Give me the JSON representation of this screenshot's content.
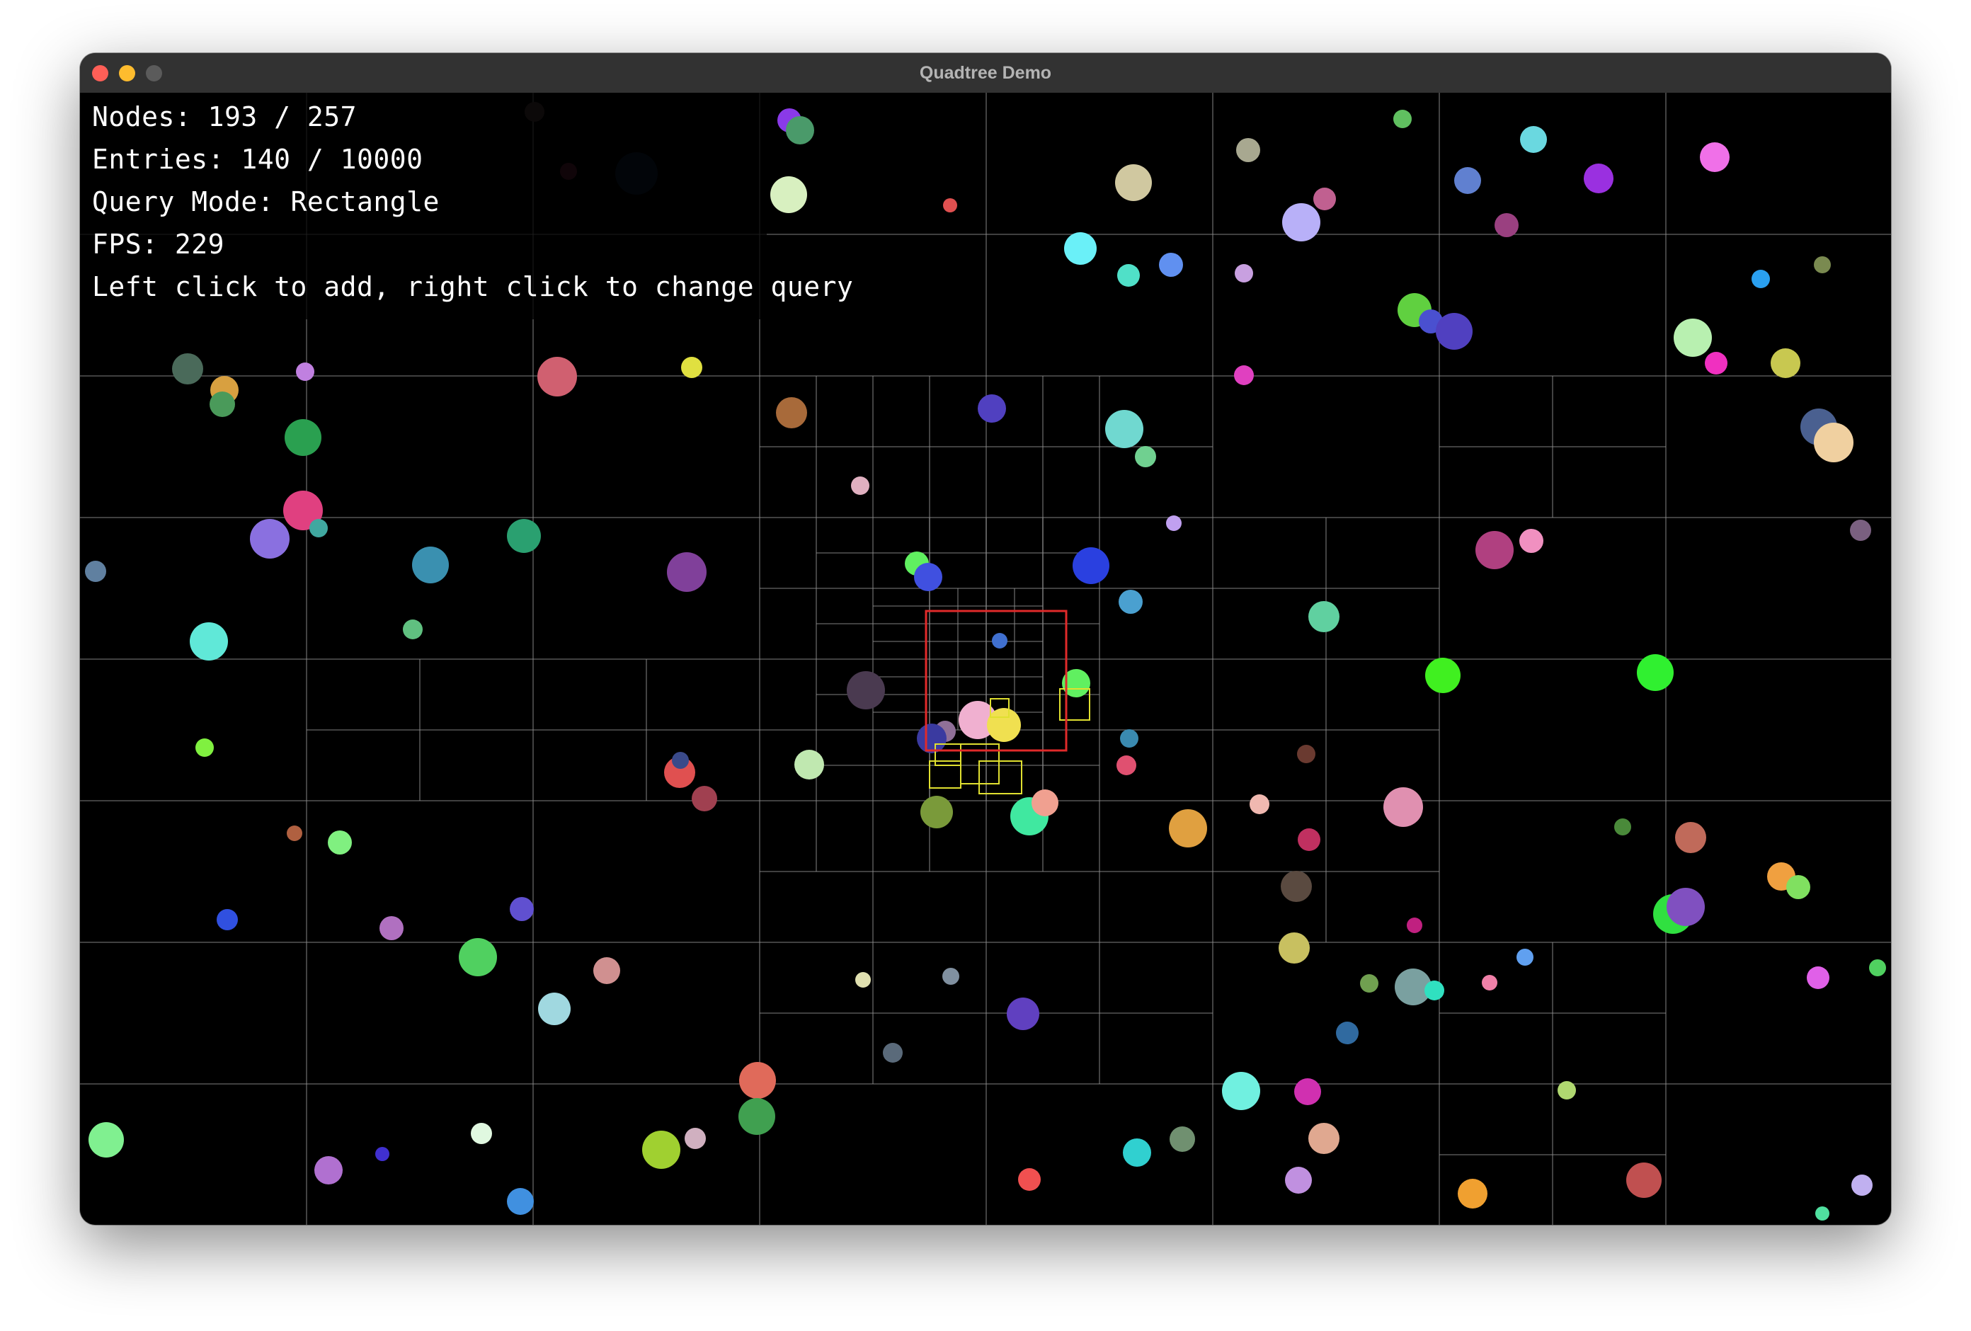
{
  "window": {
    "title": "Quadtree Demo"
  },
  "hud": {
    "nodes": "Nodes: 193 / 257",
    "entries": "Entries: 140 / 10000",
    "query_mode": "Query Mode: Rectangle",
    "fps": "FPS: 229",
    "help": "Left click to add, right click to change query"
  },
  "colors": {
    "background": "#000000",
    "grid_line": "#8a8a8a",
    "query_rect": "#e02a2a",
    "highlight_box": "#e0e030",
    "titlebar": "#323232"
  },
  "icons": {
    "close": "close-traffic-light",
    "minimize": "minimize-traffic-light",
    "zoom": "zoom-traffic-light"
  },
  "balls": [
    [
      "#3a2a2a"
    ],
    [
      "#4a1a2a"
    ],
    [
      "#8a3ae8"
    ],
    [
      "#4a9a6a"
    ],
    [
      "#0a1a2a"
    ],
    [
      "#d8f0c0"
    ],
    [
      "#e05050"
    ],
    [
      "#d0c8a0"
    ],
    [
      "#a8a890"
    ],
    [
      "#60c060"
    ],
    [
      "#6ad8e0"
    ],
    [
      "#6080d0"
    ],
    [
      "#9a30e0"
    ],
    [
      "#f070e8"
    ],
    [
      "#c06090"
    ],
    [
      "#b8b0f8"
    ],
    [
      "#9a4080"
    ],
    [
      "#6af0f8"
    ],
    [
      "#6090f0"
    ],
    [
      "#50e0c8"
    ],
    [
      "#c8a0e0"
    ],
    [
      "#2aa0f0"
    ],
    [
      "#7a8a50"
    ],
    [
      "#60d040"
    ],
    [
      "#4a50d0"
    ],
    [
      "#5040c0"
    ],
    [
      "#b8f0b0"
    ],
    [
      "#c8c850"
    ],
    [
      "#e040c0"
    ],
    [
      "#f030c0"
    ],
    [
      "#4a6a5a"
    ],
    [
      "#d8a040"
    ],
    [
      "#4a9a5a"
    ],
    [
      "#c080e0"
    ],
    [
      "#d06070"
    ],
    [
      "#e0e040"
    ],
    [
      "#a86a3a"
    ],
    [
      "#5040c0"
    ],
    [
      "#70d8d0"
    ],
    [
      "#70d090"
    ],
    [
      "#2aa050"
    ],
    [
      "#e0b0c0"
    ],
    [
      "#4a6090"
    ],
    [
      "#f0d0a0"
    ],
    [
      "#e04080"
    ],
    [
      "#8a70e0"
    ],
    [
      "#40a8a0"
    ],
    [
      "#7a6080"
    ],
    [
      "#2aa070"
    ],
    [
      "#3a90b0"
    ],
    [
      "#80409a"
    ],
    [
      "#c0a0f0"
    ],
    [
      "#b04080"
    ],
    [
      "#f090c0"
    ],
    [
      "#6080a0"
    ],
    [
      "#60f060"
    ],
    [
      "#4050e0"
    ],
    [
      "#2a40e0"
    ],
    [
      "#4aa0d0"
    ],
    [
      "#60d0a0"
    ],
    [
      "#60e8d8"
    ],
    [
      "#60c080"
    ],
    [
      "#30f030"
    ],
    [
      "#4a3a50"
    ],
    [
      "#80f040"
    ],
    [
      "#e05050"
    ],
    [
      "#3a4a8a"
    ],
    [
      "#c0e8b0"
    ],
    [
      "#40f020"
    ],
    [
      "#a04050"
    ],
    [
      "#907098"
    ],
    [
      "#f0b0d0"
    ],
    [
      "#f0e050"
    ],
    [
      "#60f060"
    ],
    [
      "#4070d0"
    ],
    [
      "#3a3aa0"
    ],
    [
      "#7a9a3a"
    ],
    [
      "#40e8a0"
    ],
    [
      "#f0a090"
    ],
    [
      "#e05070"
    ],
    [
      "#3a8ab0"
    ],
    [
      "#6a3a30"
    ],
    [
      "#f0b8b0"
    ],
    [
      "#e0a040"
    ],
    [
      "#c03060"
    ],
    [
      "#e090b0"
    ],
    [
      "#4a8a3a"
    ],
    [
      "#c06a5a"
    ],
    [
      "#f0a040"
    ],
    [
      "#80e060"
    ],
    [
      "#30e040"
    ],
    [
      "#8050c0"
    ],
    [
      "#b06040"
    ],
    [
      "#80f080"
    ],
    [
      "#3050e0"
    ],
    [
      "#b070c0"
    ],
    [
      "#6050d0"
    ],
    [
      "#50d060"
    ],
    [
      "#d09090"
    ],
    [
      "#a0d8e0"
    ],
    [
      "#e0e0b0"
    ],
    [
      "#5a4a40"
    ],
    [
      "#c8c060"
    ],
    [
      "#c02080"
    ],
    [
      "#f080a8"
    ],
    [
      "#8090a0"
    ],
    [
      "#6040c0"
    ],
    [
      "#e06a5a"
    ],
    [
      "#5a6a7a"
    ],
    [
      "#70a050"
    ],
    [
      "#7aa0a0"
    ],
    [
      "#30e0c0"
    ],
    [
      "#306aa0"
    ],
    [
      "#60a0f0"
    ],
    [
      "#e060e8"
    ],
    [
      "#50d060"
    ],
    [
      "#70f0e0"
    ],
    [
      "#d030b0"
    ],
    [
      "#b0d870"
    ],
    [
      "#80f090"
    ],
    [
      "#b070d0"
    ],
    [
      "#4030d0"
    ],
    [
      "#e0f8e0"
    ],
    [
      "#d0b0c0"
    ],
    [
      "#a0d030"
    ],
    [
      "#40a050"
    ],
    [
      "#f05050"
    ],
    [
      "#30d0d0"
    ],
    [
      "#709070"
    ],
    [
      "#e0a890"
    ],
    [
      "#c090e0"
    ],
    [
      "#f0a030"
    ],
    [
      "#c05050"
    ],
    [
      "#c0b0f0"
    ],
    [
      "#50e0a0"
    ],
    [
      "#4090e0"
    ]
  ]
}
